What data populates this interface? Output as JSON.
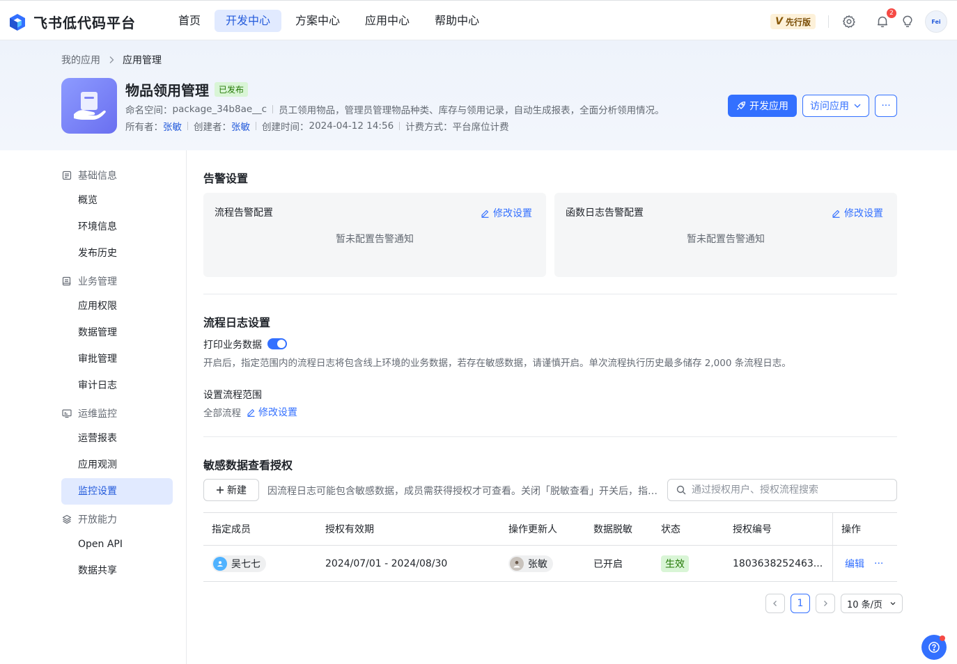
{
  "brand": {
    "name": "飞书低代码平台",
    "logo_icon": "feishu-logo-icon"
  },
  "nav": {
    "tabs": [
      {
        "label": "首页",
        "active": false
      },
      {
        "label": "开发中心",
        "active": true
      },
      {
        "label": "方案中心",
        "active": false
      },
      {
        "label": "应用中心",
        "active": false
      },
      {
        "label": "帮助中心",
        "active": false
      }
    ],
    "edition_v": "V",
    "edition_label": "先行版",
    "notification_count": "2",
    "avatar_text": "Fei"
  },
  "breadcrumb": {
    "parent": "我的应用",
    "current": "应用管理"
  },
  "app": {
    "name": "物品领用管理",
    "status": "已发布",
    "namespace_label": "命名空间：",
    "namespace": "package_34b8ae__c",
    "description": "员工领用物品，管理员管理物品种类、库存与领用记录，自动生成报表，全面分析领用情况。",
    "owner_label": "所有者：",
    "owner": "张敏",
    "creator_label": "创建者：",
    "creator": "张敏",
    "created_label": "创建时间：",
    "created_time": "2024-04-12 14:56",
    "billing_label": "计费方式：",
    "billing": "平台席位计费"
  },
  "actions": {
    "develop": "开发应用",
    "visit": "访问应用",
    "more": "···"
  },
  "sidebar": {
    "groups": [
      {
        "label": "基础信息",
        "icon": "document-icon",
        "items": [
          "概览",
          "环境信息",
          "发布历史"
        ]
      },
      {
        "label": "业务管理",
        "icon": "briefcase-icon",
        "items": [
          "应用权限",
          "数据管理",
          "审批管理",
          "审计日志"
        ]
      },
      {
        "label": "运维监控",
        "icon": "monitor-icon",
        "items": [
          "运营报表",
          "应用观测",
          "监控设置"
        ]
      },
      {
        "label": "开放能力",
        "icon": "layers-icon",
        "items": [
          "Open API",
          "数据共享"
        ]
      }
    ],
    "active_item": "监控设置"
  },
  "alerts": {
    "title": "告警设置",
    "cards": [
      {
        "title": "流程告警配置",
        "edit": "修改设置",
        "empty": "暂未配置告警通知"
      },
      {
        "title": "函数日志告警配置",
        "edit": "修改设置",
        "empty": "暂未配置告警通知"
      }
    ]
  },
  "flow_log": {
    "title": "流程日志设置",
    "print_label": "打印业务数据",
    "print_enabled": true,
    "hint": "开启后，指定范围内的流程日志将包含线上环境的业务数据，若存在敏感数据，请谨慎开启。单次流程执行历史最多储存 2,000 条流程日志。",
    "scope_label": "设置流程范围",
    "scope_value": "全部流程",
    "scope_edit": "修改设置"
  },
  "sensitive": {
    "title": "敏感数据查看授权",
    "new_button": "新建",
    "notice": "因流程日志可能包含敏感数据，成员需获得授权才可查看。关闭「脱敏查看」开关后，指定成员可查看流程日志中的完整业务数据。",
    "search_placeholder": "通过授权用户、授权流程搜索",
    "columns": [
      "指定成员",
      "授权有效期",
      "操作更新人",
      "数据脱敏",
      "状态",
      "授权编号",
      "操作"
    ],
    "rows": [
      {
        "member": "吴七七",
        "period": "2024/07/01 - 2024/08/30",
        "updater": "张敏",
        "masking": "已开启",
        "status": "生效",
        "auth_id": "1803638252463...",
        "edit": "编辑",
        "more": "···"
      }
    ]
  },
  "pagination": {
    "current": "1",
    "page_size": "10 条/页"
  },
  "colors": {
    "primary": "#3370ff",
    "active_bg": "#e1eaff",
    "success_bg": "#d9f5d6",
    "success_text": "#237804",
    "danger": "#f54a45"
  }
}
